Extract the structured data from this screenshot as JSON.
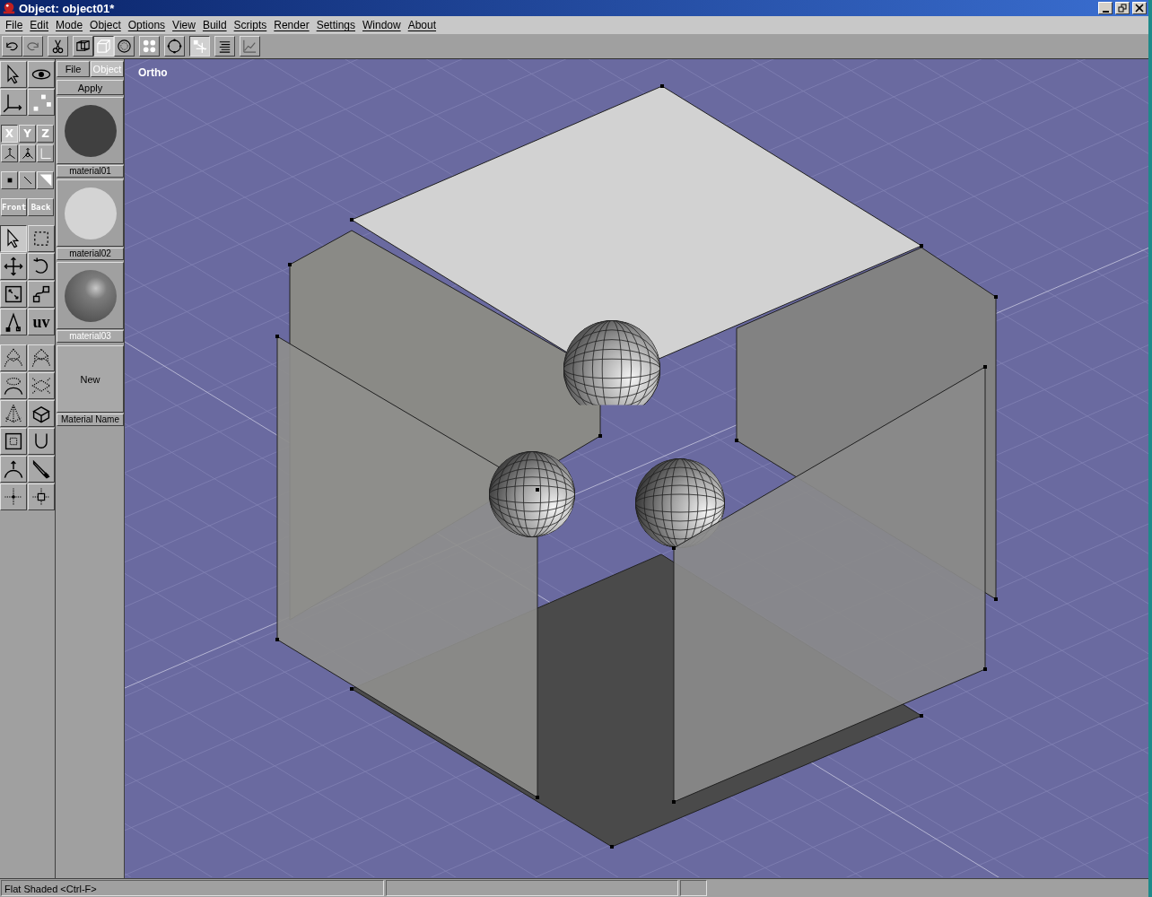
{
  "window": {
    "title": "Object: object01*"
  },
  "menu": [
    "File",
    "Edit",
    "Mode",
    "Object",
    "Options",
    "View",
    "Build",
    "Scripts",
    "Render",
    "Settings",
    "Window",
    "About"
  ],
  "toolbar": [
    {
      "selected": false,
      "disabled": false
    },
    {
      "selected": false,
      "disabled": true
    },
    {
      "selected": false,
      "disabled": false
    },
    {
      "selected": false,
      "disabled": false
    },
    {
      "selected": true,
      "disabled": false
    },
    {
      "selected": false,
      "disabled": false
    },
    {
      "selected": false,
      "disabled": false
    },
    {
      "selected": false,
      "disabled": false
    },
    {
      "selected": true,
      "disabled": false
    },
    {
      "selected": false,
      "disabled": false
    },
    {
      "selected": false,
      "disabled": true
    }
  ],
  "tool_palette": {
    "view_tools": [
      {
        "selected": false
      },
      {
        "selected": false
      },
      {
        "selected": false
      },
      {
        "selected": false
      }
    ],
    "axes": [
      {
        "label": "X",
        "selected": true
      },
      {
        "label": "Y",
        "selected": false
      },
      {
        "label": "Z",
        "selected": false
      }
    ],
    "handles": [
      {
        "selected": false
      },
      {
        "selected": false
      },
      {
        "selected": false
      }
    ],
    "elements": [
      {
        "selected": false
      },
      {
        "selected": false
      },
      {
        "selected": false
      }
    ],
    "sides": [
      {
        "label": "Front",
        "selected": false
      },
      {
        "label": "Back",
        "selected": false
      }
    ],
    "edit_tools": [
      {
        "selected": true
      },
      {
        "selected": false
      },
      {
        "selected": false
      },
      {
        "selected": false
      },
      {
        "selected": false
      },
      {
        "selected": false
      },
      {
        "selected": false
      },
      {
        "label": "uv",
        "selected": false
      }
    ],
    "modelling_tools": [
      {
        "selected": false
      },
      {
        "selected": false
      },
      {
        "selected": false
      },
      {
        "selected": false
      },
      {
        "selected": false
      },
      {
        "selected": false
      },
      {
        "selected": false
      },
      {
        "selected": false
      },
      {
        "selected": false
      },
      {
        "selected": false
      },
      {
        "selected": false
      },
      {
        "selected": false
      }
    ]
  },
  "material_panel": {
    "tabs": [
      {
        "label": "File",
        "selected": false
      },
      {
        "label": "Object",
        "selected": true
      }
    ],
    "apply": "Apply",
    "materials": [
      {
        "name": "material01",
        "kind": "flat",
        "color": "#404040"
      },
      {
        "name": "material02",
        "kind": "flat",
        "color": "#d4d4d4"
      },
      {
        "name": "material03",
        "kind": "shiny",
        "color": "#7c7c7c"
      }
    ],
    "new_button": "New",
    "name_label": "Material Name"
  },
  "viewport": {
    "label": "Ortho"
  },
  "status_bar": [
    "Flat Shaded  <Ctrl-F>"
  ]
}
